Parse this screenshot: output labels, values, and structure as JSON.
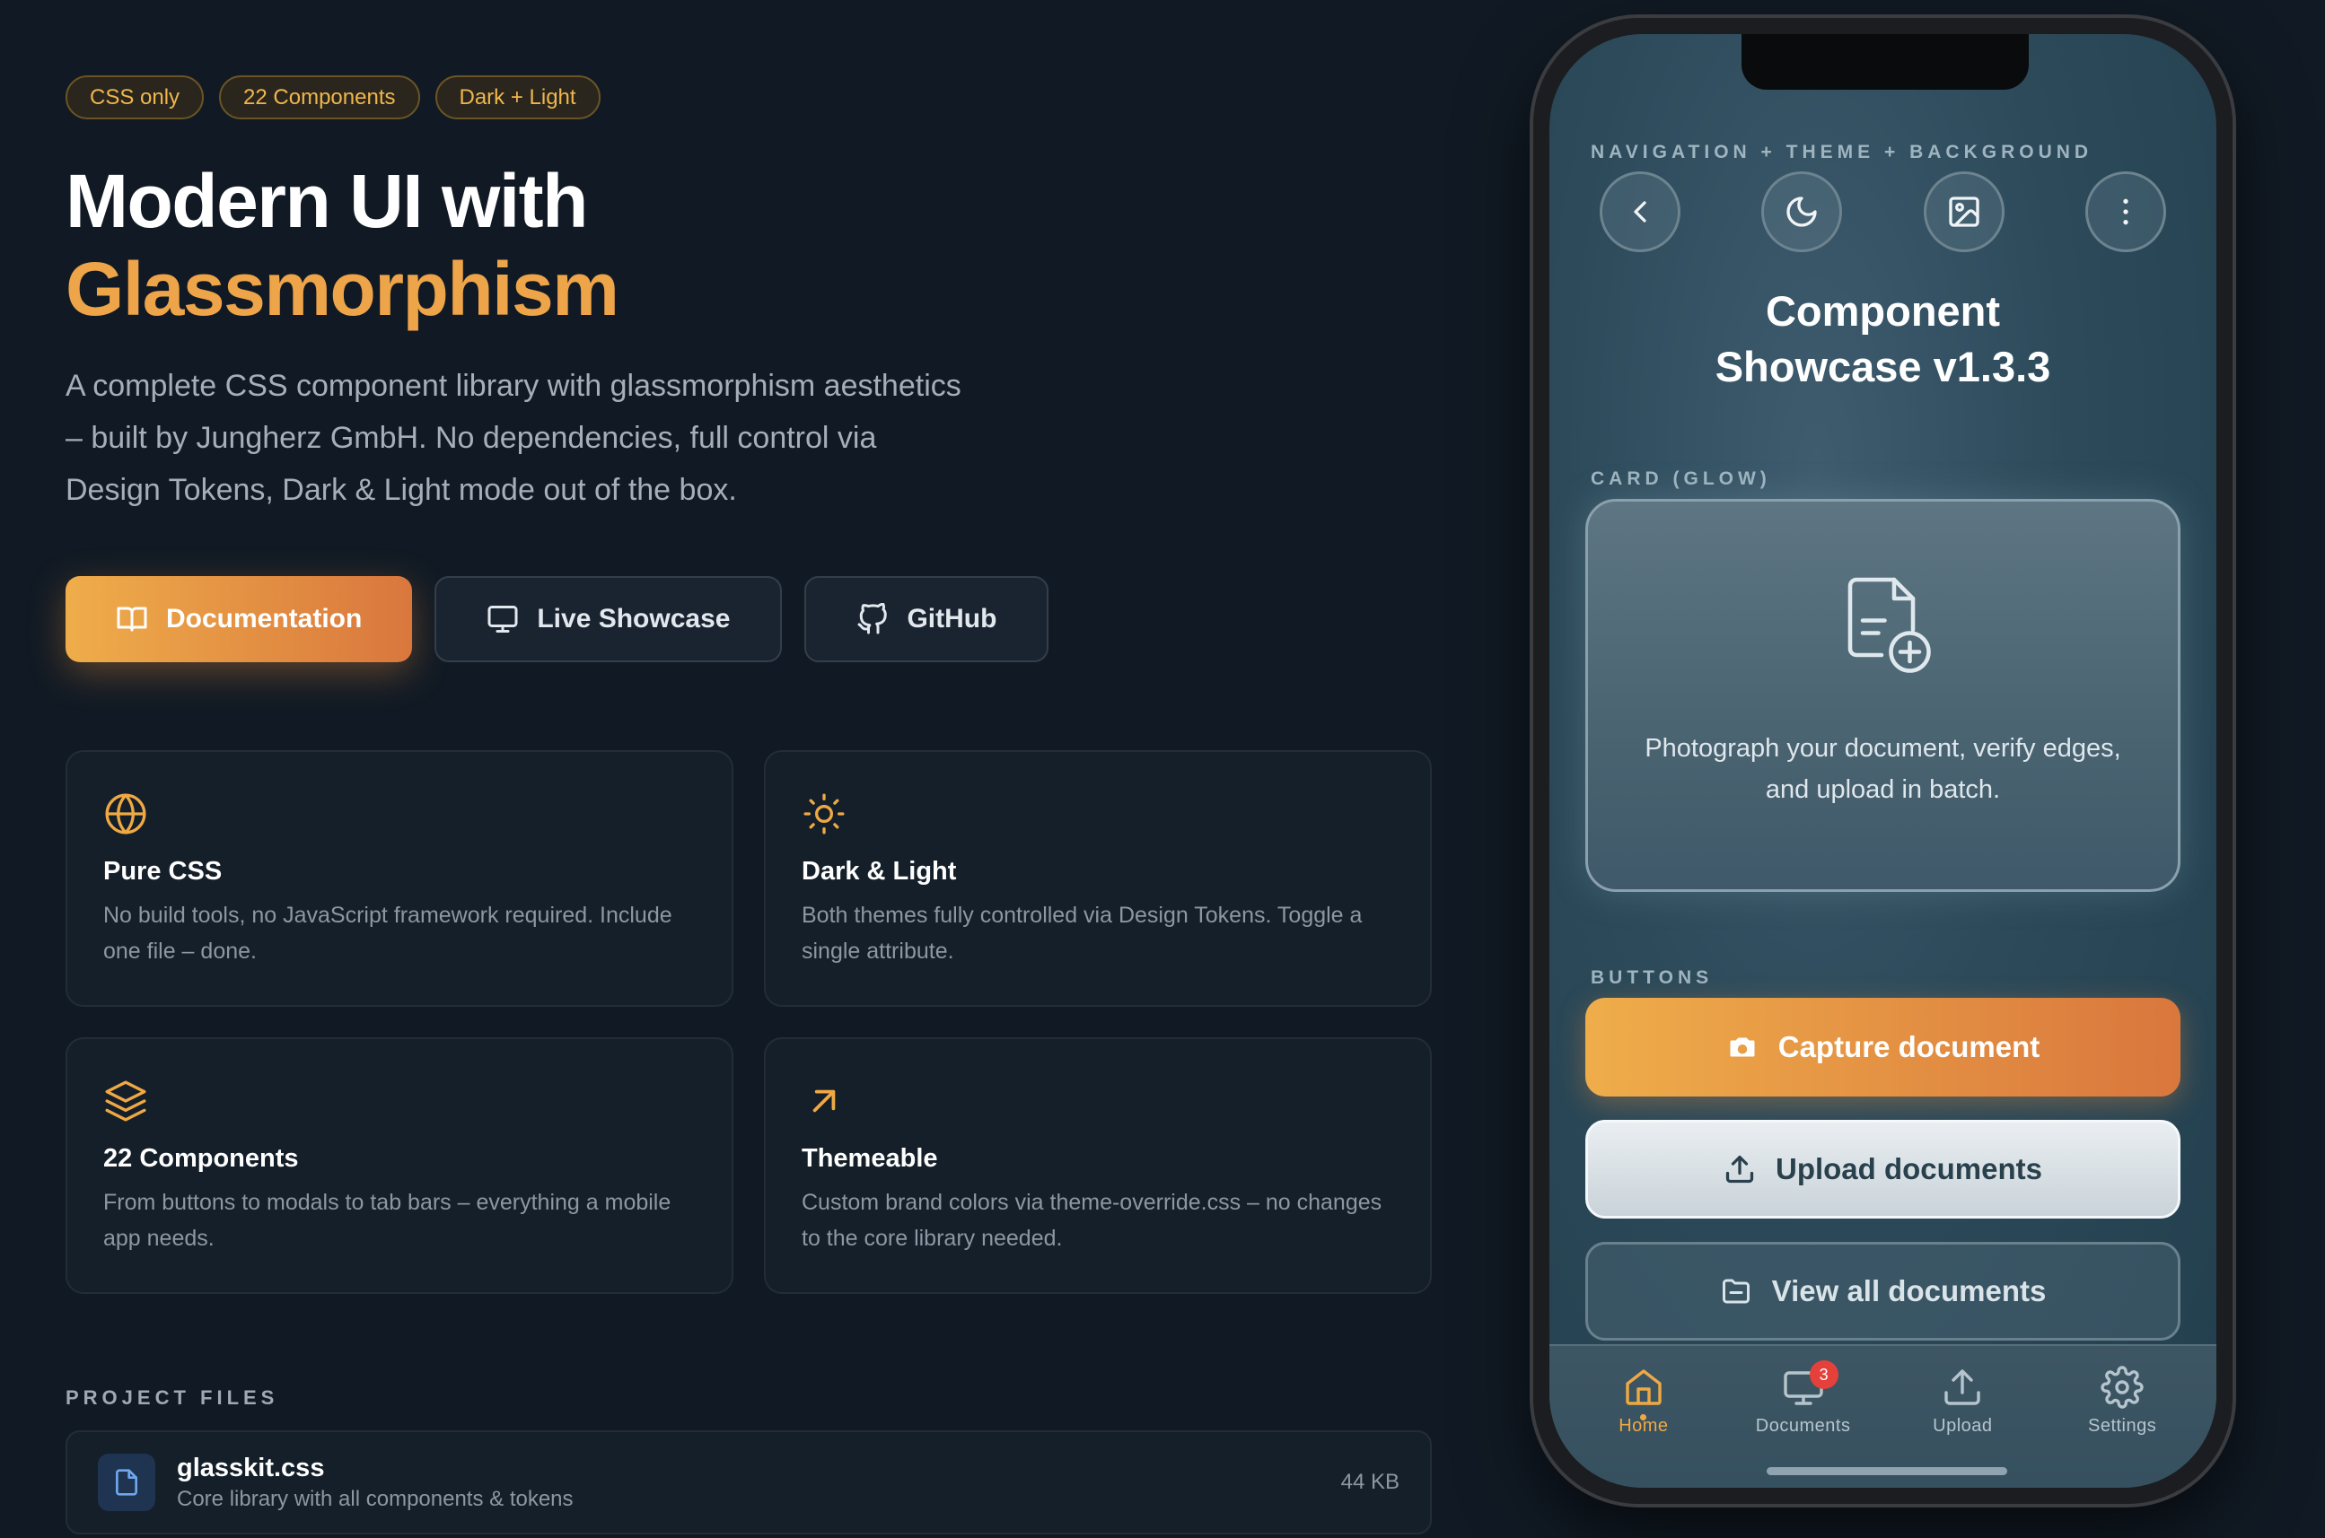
{
  "badges": [
    "CSS only",
    "22 Components",
    "Dark + Light"
  ],
  "hero": {
    "title_line1": "Modern UI with",
    "title_line2": "Glassmorphism",
    "description": "A complete CSS component library with glassmorphism aesthetics – built by Jungherz GmbH. No dependencies, full control via Design Tokens, Dark & Light mode out of the box."
  },
  "cta": {
    "documentation": "Documentation",
    "live_showcase": "Live Showcase",
    "github": "GitHub"
  },
  "features": [
    {
      "icon": "globe-icon",
      "title": "Pure CSS",
      "desc": "No build tools, no JavaScript framework required. Include one file – done."
    },
    {
      "icon": "sun-icon",
      "title": "Dark & Light",
      "desc": "Both themes fully controlled via Design Tokens. Toggle a single attribute."
    },
    {
      "icon": "layers-icon",
      "title": "22 Components",
      "desc": "From buttons to modals to tab bars – everything a mobile app needs."
    },
    {
      "icon": "arrow-up-right-icon",
      "title": "Themeable",
      "desc": "Custom brand colors via theme-override.css – no changes to the core library needed."
    }
  ],
  "project_files": {
    "label": "PROJECT FILES",
    "files": [
      {
        "name": "glasskit.css",
        "desc": "Core library with all components & tokens",
        "size": "44 KB"
      }
    ]
  },
  "phone": {
    "nav_label": "NAVIGATION + THEME + BACKGROUND",
    "title_line1": "Component",
    "title_line2": "Showcase v1.3.3",
    "card_label": "CARD (GLOW)",
    "card_text": "Photograph your document, verify edges, and upload in batch.",
    "buttons_label": "BUTTONS",
    "btn_capture": "Capture document",
    "btn_upload": "Upload documents",
    "btn_view": "View all documents",
    "tabs": [
      {
        "label": "Home",
        "icon": "home-icon",
        "active": true
      },
      {
        "label": "Documents",
        "icon": "monitor-icon",
        "badge": "3"
      },
      {
        "label": "Upload",
        "icon": "upload-icon"
      },
      {
        "label": "Settings",
        "icon": "gear-icon"
      }
    ]
  },
  "colors": {
    "accent": "#eea448",
    "background": "#111a24",
    "badge_red": "#e5413a"
  }
}
